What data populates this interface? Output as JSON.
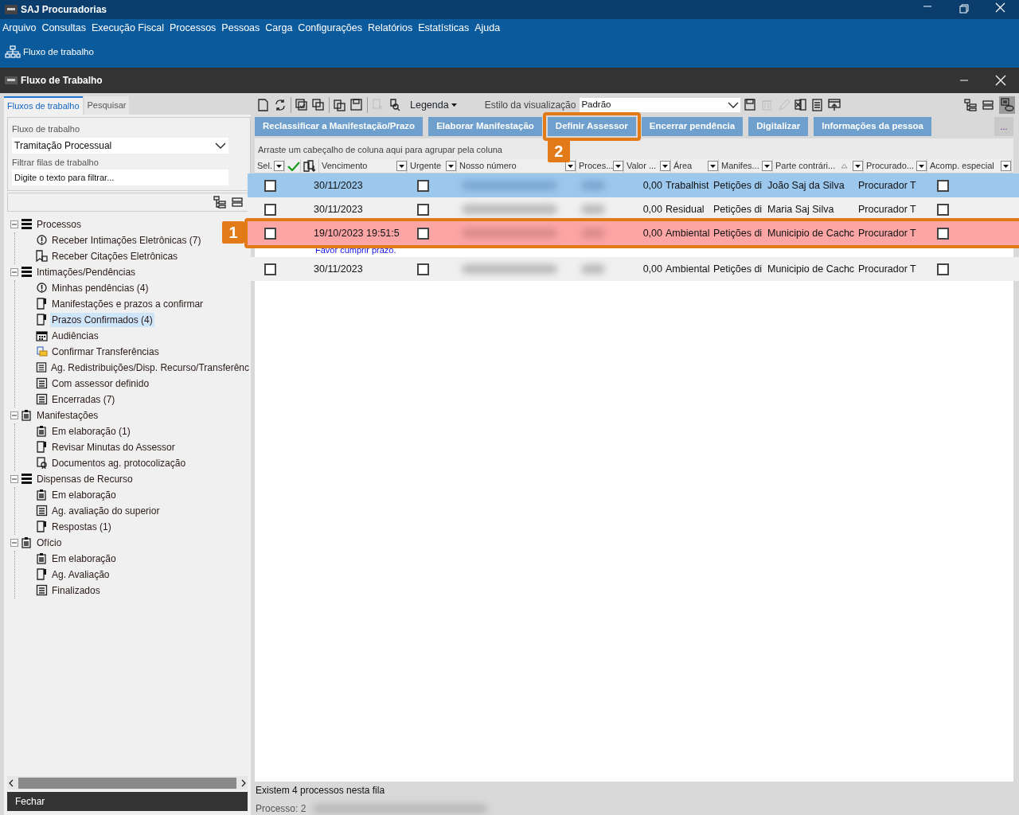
{
  "app_title": "SAJ Procuradorias",
  "menu": [
    "Arquivo",
    "Consultas",
    "Execução Fiscal",
    "Processos",
    "Pessoas",
    "Carga",
    "Configurações",
    "Relatórios",
    "Estatísticas",
    "Ajuda"
  ],
  "quick_link": "Fluxo de trabalho",
  "window_title": "Fluxo de Trabalho",
  "left_tabs": [
    {
      "label": "Fluxos de trabalho",
      "selected": true
    },
    {
      "label": "Pesquisar",
      "selected": false
    }
  ],
  "workflow_label": "Fluxo de trabalho",
  "workflow_value": "Tramitação Processual",
  "filter_label": "Filtrar filas de trabalho",
  "filter_placeholder": "Digite o texto para filtrar...",
  "tree": [
    {
      "label": "Processos",
      "kind": "stack",
      "expanded": true,
      "selected": false,
      "children": [
        {
          "label": "Receber Intimações Eletrônicas (7)",
          "kind": "alert",
          "selected": false
        },
        {
          "label": "Receber Citações Eletrônicas",
          "kind": "citation",
          "selected": false
        }
      ]
    },
    {
      "label": "Intimações/Pendências",
      "kind": "stack",
      "expanded": true,
      "selected": false,
      "children": [
        {
          "label": "Minhas pendências (4)",
          "kind": "alert",
          "selected": false
        },
        {
          "label": "Manifestações e prazos a confirmar",
          "kind": "flag",
          "selected": false
        },
        {
          "label": "Prazos Confirmados (4)",
          "kind": "flag",
          "selected": true
        },
        {
          "label": "Audiências",
          "kind": "calendar",
          "selected": false
        },
        {
          "label": "Confirmar Transferências",
          "kind": "transfer",
          "selected": false
        },
        {
          "label": "Ag. Redistribuições/Disp. Recurso/Transferênc",
          "kind": "form",
          "selected": false
        },
        {
          "label": "Com assessor definido",
          "kind": "form",
          "selected": false
        },
        {
          "label": "Encerradas (7)",
          "kind": "form",
          "selected": false
        }
      ]
    },
    {
      "label": "Manifestações",
      "kind": "clipboard",
      "expanded": true,
      "selected": false,
      "children": [
        {
          "label": "Em elaboração (1)",
          "kind": "clipboard",
          "selected": false
        },
        {
          "label": "Revisar Minutas do Assessor",
          "kind": "flag",
          "selected": false
        },
        {
          "label": "Documentos ag. protocolização",
          "kind": "cert",
          "selected": false
        }
      ]
    },
    {
      "label": "Dispensas de Recurso",
      "kind": "stack",
      "expanded": true,
      "selected": false,
      "children": [
        {
          "label": "Em elaboração",
          "kind": "clipboard",
          "selected": false
        },
        {
          "label": "Ag. avaliação do superior",
          "kind": "form",
          "selected": false
        },
        {
          "label": "Respostas (1)",
          "kind": "flag",
          "selected": false
        }
      ]
    },
    {
      "label": "Ofício",
      "kind": "clipboard",
      "expanded": true,
      "selected": false,
      "children": [
        {
          "label": "Em elaboração",
          "kind": "clipboard",
          "selected": false
        },
        {
          "label": "Ag. Avaliação",
          "kind": "flag",
          "selected": false
        },
        {
          "label": "Finalizados",
          "kind": "form",
          "selected": false
        }
      ]
    }
  ],
  "close_button": "Fechar",
  "legend_label": "Legenda",
  "view_style_label": "Estilo da visualização",
  "view_style_value": "Padrão",
  "actions": [
    {
      "label": "Reclassificar a Manifestação/Prazo"
    },
    {
      "label": "Elaborar Manifestação"
    },
    {
      "label": "Definir Assessor",
      "callout": "2"
    },
    {
      "label": "Encerrar pendência"
    },
    {
      "label": "Digitalizar"
    },
    {
      "label": "Informações da pessoa"
    }
  ],
  "more_button": "...",
  "group_hint": "Arraste um cabeçalho de coluna aqui para agrupar pela coluna",
  "columns": [
    {
      "label": "Sel.",
      "kind": "checkbox",
      "sorted": false
    },
    {
      "kind": "icon-check"
    },
    {
      "kind": "icon-docs"
    },
    {
      "label": "Vencimento",
      "kind": "text",
      "sorted": false
    },
    {
      "label": "Urgente",
      "kind": "checkbox",
      "sorted": false
    },
    {
      "label": "Nosso número",
      "kind": "blurred",
      "sorted": false
    },
    {
      "label": "Proces...",
      "kind": "blurred",
      "sorted": false
    },
    {
      "label": "Valor ...",
      "kind": "number",
      "sorted": false
    },
    {
      "label": "Área",
      "kind": "text",
      "sorted": false
    },
    {
      "label": "Manifes...",
      "kind": "text",
      "sorted": false
    },
    {
      "label": "Parte contrári...",
      "kind": "text",
      "sorted": true
    },
    {
      "label": "Procurado...",
      "kind": "text",
      "sorted": false
    },
    {
      "label": "Acomp. especial",
      "kind": "checkbox",
      "sorted": false
    }
  ],
  "rows": [
    {
      "selected": true,
      "overdue": false,
      "cells": [
        false,
        "30/11/2023",
        false,
        "0,00",
        "Trabalhist",
        "Petições di",
        "João Saj da Silva",
        "Procurador T",
        false
      ]
    },
    {
      "selected": false,
      "overdue": false,
      "cells": [
        false,
        "30/11/2023",
        false,
        "0,00",
        "Residual",
        "Petições di",
        "Maria Saj Silva",
        "Procurador T",
        false
      ]
    },
    {
      "selected": false,
      "overdue": true,
      "callout": "1",
      "cells": [
        false,
        "19/10/2023 19:51:5",
        false,
        "0,00",
        "Ambiental",
        "Petições di",
        "Municipio de Cachc",
        "Procurador T",
        false
      ],
      "note": "Favor cumprir prazo."
    },
    {
      "selected": false,
      "overdue": false,
      "cells": [
        false,
        "30/11/2023",
        false,
        "0,00",
        "Ambiental",
        "Petições di",
        "Municipio de Cachc",
        "Procurador T",
        false
      ]
    }
  ],
  "status_count": "Existem 4 processos nesta fila",
  "status_process": "Processo: 2"
}
